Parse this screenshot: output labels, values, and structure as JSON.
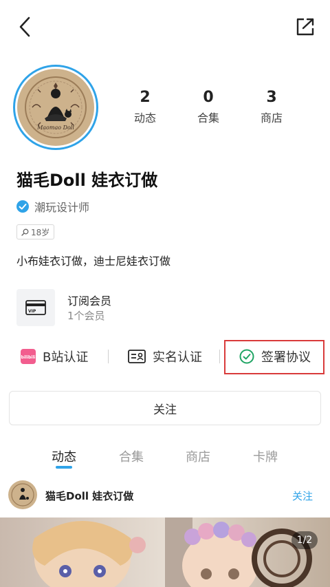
{
  "profile": {
    "name": "猫毛Doll 娃衣订做",
    "verify_text": "潮玩设计师",
    "age_tag": "18岁",
    "bio": "小布娃衣订做，迪士尼娃衣订做",
    "avatar_logo_text": "Maomao Doll"
  },
  "stats": [
    {
      "value": "2",
      "label": "动态"
    },
    {
      "value": "0",
      "label": "合集"
    },
    {
      "value": "3",
      "label": "商店"
    }
  ],
  "membership": {
    "title": "订阅会员",
    "subtitle": "1个会员",
    "card_text": "VIP"
  },
  "auth": {
    "bilibili_logo": "bilibili",
    "bilibili": "B站认证",
    "realname": "实名认证",
    "agreement": "签署协议"
  },
  "follow_label": "关注",
  "tabs": [
    "动态",
    "合集",
    "商店",
    "卡牌"
  ],
  "active_tab": "动态",
  "post": {
    "author": "猫毛Doll 娃衣订做",
    "follow": "关注",
    "page": "1/2"
  },
  "colors": {
    "accent": "#2fa3e8",
    "highlight": "#d93a3a",
    "bilibili": "#f25d8e",
    "verify": "#2fa3e8",
    "check": "#1ea463"
  },
  "icons": {
    "back": "back-arrow-icon",
    "share": "share-icon",
    "verify": "verified-check-icon",
    "card": "vip-card-icon",
    "bilibili": "bilibili-logo-icon",
    "realname": "id-card-icon",
    "agreement": "check-circle-icon"
  }
}
